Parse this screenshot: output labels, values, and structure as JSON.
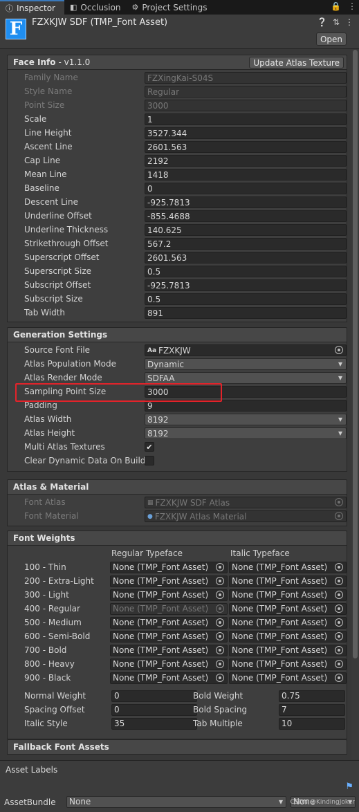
{
  "tabs": [
    {
      "label": "Inspector",
      "icon": "info-icon"
    },
    {
      "label": "Occlusion",
      "icon": "occlusion-icon"
    },
    {
      "label": "Project Settings",
      "icon": "gear-icon"
    }
  ],
  "header": {
    "logo_letter": "F",
    "title": "FZXKJW SDF (TMP_Font Asset)",
    "open_label": "Open"
  },
  "face_info": {
    "title": "Face Info",
    "version": "- v1.1.0",
    "update_button": "Update Atlas Texture",
    "rows": [
      {
        "label": "Family Name",
        "value": "FZXingKai-S04S",
        "disabled": true
      },
      {
        "label": "Style Name",
        "value": "Regular",
        "disabled": true
      },
      {
        "label": "Point Size",
        "value": "3000",
        "disabled": true
      },
      {
        "label": "Scale",
        "value": "1"
      },
      {
        "label": "Line Height",
        "value": "3527.344"
      },
      {
        "label": "Ascent Line",
        "value": "2601.563"
      },
      {
        "label": "Cap Line",
        "value": "2192"
      },
      {
        "label": "Mean Line",
        "value": "1418"
      },
      {
        "label": "Baseline",
        "value": "0"
      },
      {
        "label": "Descent Line",
        "value": "-925.7813"
      },
      {
        "label": "Underline Offset",
        "value": "-855.4688"
      },
      {
        "label": "Underline Thickness",
        "value": "140.625"
      },
      {
        "label": "Strikethrough Offset",
        "value": "567.2"
      },
      {
        "label": "Superscript Offset",
        "value": "2601.563"
      },
      {
        "label": "Superscript Size",
        "value": "0.5"
      },
      {
        "label": "Subscript Offset",
        "value": "-925.7813"
      },
      {
        "label": "Subscript Size",
        "value": "0.5"
      },
      {
        "label": "Tab Width",
        "value": "891"
      }
    ]
  },
  "generation": {
    "title": "Generation Settings",
    "source_font_label": "Source Font File",
    "source_font_prefix": "Aa",
    "source_font_value": "FZXKJW",
    "population_label": "Atlas Population Mode",
    "population_value": "Dynamic",
    "render_label": "Atlas Render Mode",
    "render_value": "SDFAA",
    "sampling_label": "Sampling Point Size",
    "sampling_value": "3000",
    "padding_label": "Padding",
    "padding_value": "9",
    "width_label": "Atlas Width",
    "width_value": "8192",
    "height_label": "Atlas Height",
    "height_value": "8192",
    "multi_label": "Multi Atlas Textures",
    "multi_check": "✔",
    "clear_label": "Clear Dynamic Data On Build"
  },
  "atlas_material": {
    "title": "Atlas & Material",
    "font_atlas_label": "Font Atlas",
    "font_atlas_value": "FZXKJW SDF Atlas",
    "font_material_label": "Font Material",
    "font_material_value": "FZXKJW Atlas Material"
  },
  "font_weights": {
    "title": "Font Weights",
    "regular_header": "Regular Typeface",
    "italic_header": "Italic Typeface",
    "rows": [
      {
        "label": "100 - Thin",
        "regular": "None (TMP_Font Asset)",
        "italic": "None (TMP_Font Asset)"
      },
      {
        "label": "200 - Extra-Light",
        "regular": "None (TMP_Font Asset)",
        "italic": "None (TMP_Font Asset)"
      },
      {
        "label": "300 - Light",
        "regular": "None (TMP_Font Asset)",
        "italic": "None (TMP_Font Asset)"
      },
      {
        "label": "400 - Regular",
        "regular": "None (TMP_Font Asset)",
        "italic": "None (TMP_Font Asset)",
        "regular_disabled": true
      },
      {
        "label": "500 - Medium",
        "regular": "None (TMP_Font Asset)",
        "italic": "None (TMP_Font Asset)"
      },
      {
        "label": "600 - Semi-Bold",
        "regular": "None (TMP_Font Asset)",
        "italic": "None (TMP_Font Asset)"
      },
      {
        "label": "700 - Bold",
        "regular": "None (TMP_Font Asset)",
        "italic": "None (TMP_Font Asset)"
      },
      {
        "label": "800 - Heavy",
        "regular": "None (TMP_Font Asset)",
        "italic": "None (TMP_Font Asset)"
      },
      {
        "label": "900 - Black",
        "regular": "None (TMP_Font Asset)",
        "italic": "None (TMP_Font Asset)"
      }
    ],
    "normal_weight_label": "Normal Weight",
    "normal_weight_value": "0",
    "bold_weight_label": "Bold Weight",
    "bold_weight_value": "0.75",
    "spacing_offset_label": "Spacing Offset",
    "spacing_offset_value": "0",
    "bold_spacing_label": "Bold Spacing",
    "bold_spacing_value": "7",
    "italic_style_label": "Italic Style",
    "italic_style_value": "35",
    "tab_multiple_label": "Tab Multiple",
    "tab_multiple_value": "10"
  },
  "fallback": {
    "title": "Fallback Font Assets"
  },
  "asset_labels": {
    "title": "Asset Labels",
    "assetbundle_label": "AssetBundle",
    "bundle_value": "None",
    "variant_value": "None"
  },
  "watermark": "CSDN @KindingJoker",
  "colors": {
    "accent": "#3a79bb",
    "highlight": "#e3232a",
    "logo": "#1f8ef1"
  }
}
